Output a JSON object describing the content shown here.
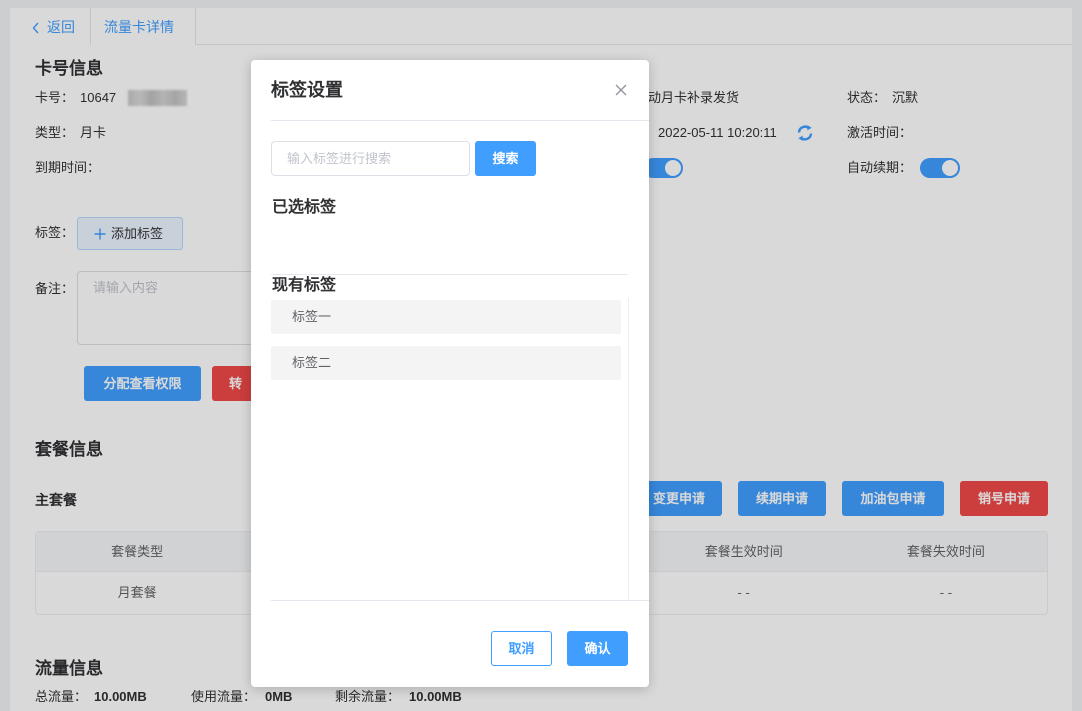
{
  "tabs": {
    "back_label": "返回",
    "current_tab": "流量卡详情"
  },
  "card_info": {
    "title": "卡号信息",
    "card_no_label": "卡号：",
    "card_no_value": "10647",
    "partial_text": "动月卡补录发货",
    "status_label": "状态：",
    "status_value": "沉默",
    "type_label": "类型：",
    "type_value": "月卡",
    "datetime": "2022-05-11 10:20:11",
    "activation_label": "激活时间：",
    "expire_label": "到期时间：",
    "auto_renew_label": "自动续期：",
    "auto_renew_on": true,
    "row3_switch_on": true
  },
  "tags": {
    "label": "标签：",
    "add_button": "添加标签"
  },
  "remark": {
    "label": "备注：",
    "placeholder": "请输入内容"
  },
  "actions": {
    "assign_button": "分配查看权限",
    "transfer_button": "转"
  },
  "package": {
    "title": "套餐信息",
    "main_label": "主套餐",
    "buttons": [
      "变更申请",
      "续期申请",
      "加油包申请",
      "销号申请"
    ],
    "table": {
      "headers": [
        "套餐类型",
        "",
        "",
        "套餐生效时间",
        "套餐失效时间"
      ],
      "rows": [
        [
          "月套餐",
          "",
          "",
          "- -",
          "- -"
        ]
      ]
    }
  },
  "traffic": {
    "title": "流量信息",
    "total_label": "总流量：",
    "total_value": "10.00MB",
    "used_label": "使用流量：",
    "used_value": "0MB",
    "remaining_label": "剩余流量：",
    "remaining_value": "10.00MB"
  },
  "modal": {
    "title": "标签设置",
    "search_placeholder": "输入标签进行搜索",
    "search_button": "搜索",
    "selected_title": "已选标签",
    "selected_tags": [],
    "existing_title": "现有标签",
    "existing_tags": [
      "标签一",
      "标签二"
    ],
    "cancel_button": "取消",
    "confirm_button": "确认"
  },
  "icons": {
    "back": "chevron-left-icon",
    "refresh": "refresh-icon",
    "add": "plus-icon",
    "close": "close-icon"
  },
  "colors": {
    "primary": "#409eff",
    "danger": "#f04848",
    "mask": "rgba(0,0,0,0.15)"
  }
}
